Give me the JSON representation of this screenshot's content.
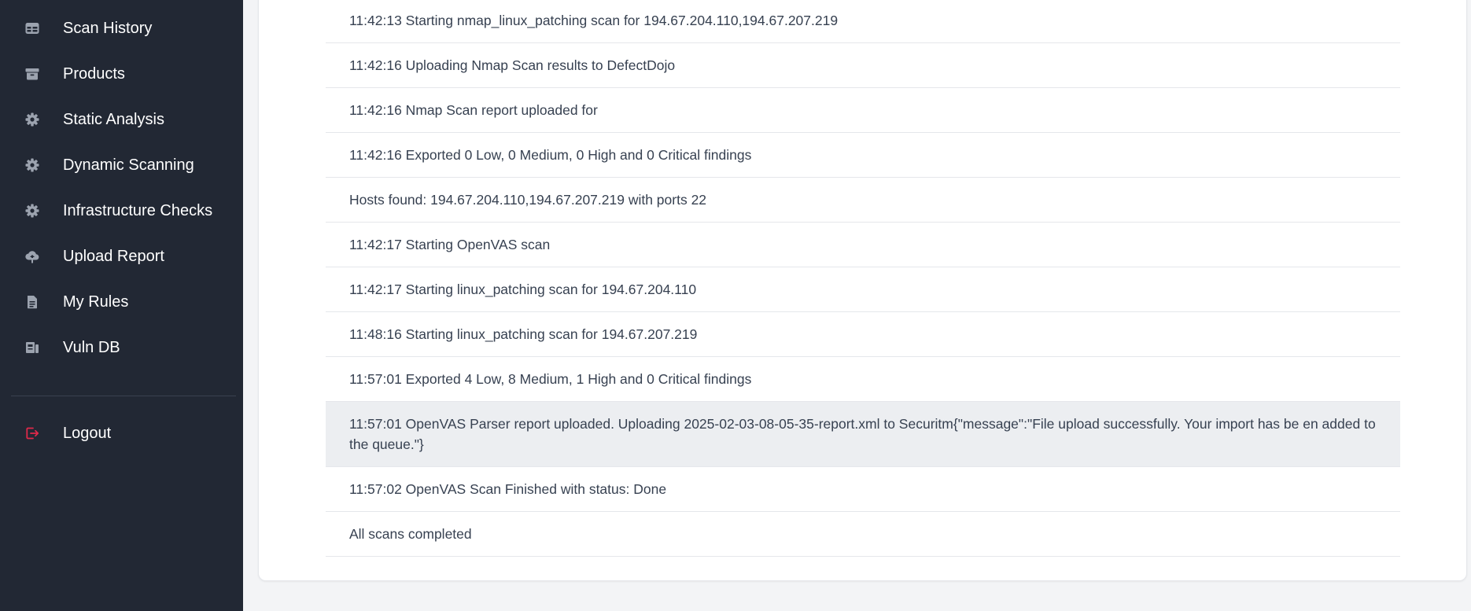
{
  "sidebar": {
    "items": [
      {
        "label": "Scan History",
        "icon": "table-icon"
      },
      {
        "label": "Products",
        "icon": "archive-icon"
      },
      {
        "label": "Static Analysis",
        "icon": "gear-icon"
      },
      {
        "label": "Dynamic Scanning",
        "icon": "gear-icon"
      },
      {
        "label": "Infrastructure Checks",
        "icon": "gear-icon"
      },
      {
        "label": "Upload Report",
        "icon": "cloud-upload-icon"
      },
      {
        "label": "My Rules",
        "icon": "document-icon"
      },
      {
        "label": "Vuln DB",
        "icon": "database-icon"
      }
    ],
    "logout": {
      "label": "Logout",
      "icon": "logout-icon"
    }
  },
  "colors": {
    "sidebar_bg": "#222834",
    "logout_icon": "#e0294a",
    "highlight_row": "#eceef1"
  },
  "log": {
    "entries": [
      "11:42:13 Starting nmap_linux_patching scan for 194.67.204.110,194.67.207.219",
      "11:42:16 Uploading Nmap Scan results to DefectDojo",
      "11:42:16 Nmap Scan report uploaded for",
      "11:42:16 Exported 0 Low, 0 Medium, 0 High and 0 Critical findings",
      "Hosts found: 194.67.204.110,194.67.207.219 with ports 22",
      "11:42:17 Starting OpenVAS scan",
      "11:42:17 Starting linux_patching scan for 194.67.204.110",
      "11:48:16 Starting linux_patching scan for 194.67.207.219",
      "11:57:01 Exported 4 Low, 8 Medium, 1 High and 0 Critical findings",
      "11:57:01 OpenVAS Parser report uploaded. Uploading 2025-02-03-08-05-35-report.xml to Securitm{\"message\":\"File upload successfully. Your import has be en added to the queue.\"}",
      "11:57:02 OpenVAS Scan Finished with status: Done",
      "All scans completed"
    ]
  }
}
